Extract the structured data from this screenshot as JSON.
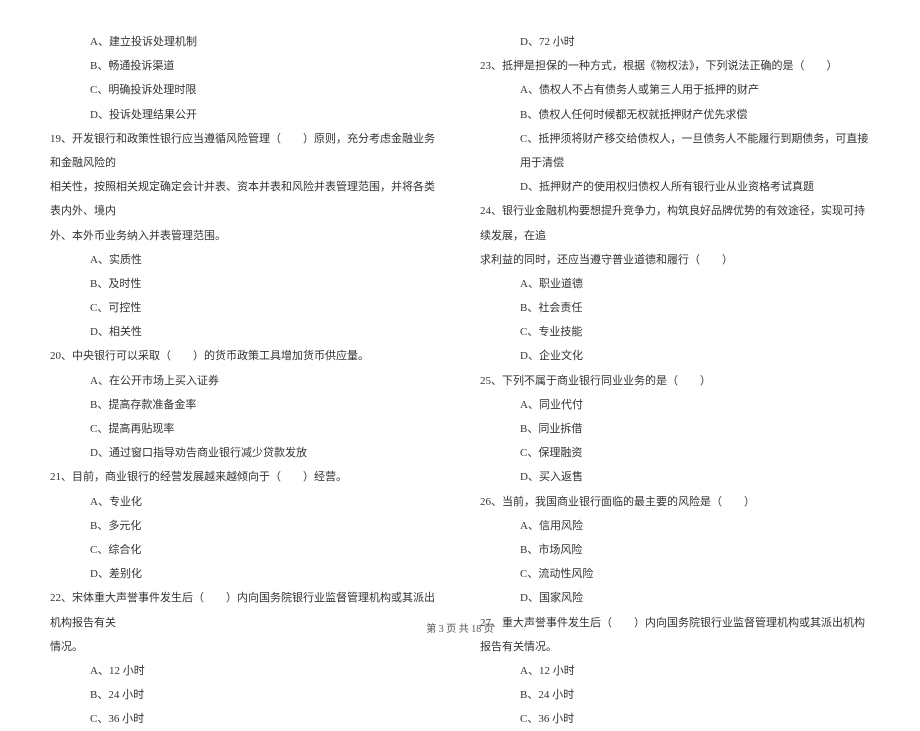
{
  "left_column": {
    "q18_opts": {
      "a": "A、建立投诉处理机制",
      "b": "B、畅通投诉渠道",
      "c": "C、明确投诉处理时限",
      "d": "D、投诉处理结果公开"
    },
    "q19": {
      "stem1": "19、开发银行和政策性银行应当遵循风险管理（　　）原则，充分考虑金融业务和金融风险的",
      "stem2": "相关性，按照相关规定确定会计并表、资本并表和风险并表管理范围，并将各类表内外、境内",
      "stem3": "外、本外币业务纳入并表管理范围。",
      "a": "A、实质性",
      "b": "B、及时性",
      "c": "C、可控性",
      "d": "D、相关性"
    },
    "q20": {
      "stem": "20、中央银行可以采取（　　）的货币政策工具增加货币供应量。",
      "a": "A、在公开市场上买入证券",
      "b": "B、提高存款准备金率",
      "c": "C、提高再贴现率",
      "d": "D、通过窗口指导劝告商业银行减少贷款发放"
    },
    "q21": {
      "stem": "21、目前，商业银行的经营发展越来越倾向于（　　）经营。",
      "a": "A、专业化",
      "b": "B、多元化",
      "c": "C、综合化",
      "d": "D、差别化"
    },
    "q22": {
      "stem1": "22、宋体重大声誉事件发生后（　　）内向国务院银行业监督管理机构或其派出机构报告有关",
      "stem2": "情况。",
      "a": "A、12 小时",
      "b": "B、24 小时",
      "c": "C、36 小时"
    }
  },
  "right_column": {
    "q22_d": "D、72 小时",
    "q23": {
      "stem": "23、抵押是担保的一种方式，根据《物权法》，下列说法正确的是（　　）",
      "a": "A、债权人不占有债务人或第三人用于抵押的财产",
      "b": "B、债权人任何时候都无权就抵押财产优先求偿",
      "c": "C、抵押须将财产移交给债权人，一旦债务人不能履行到期债务，可直接用于清偿",
      "d": "D、抵押财产的使用权归债权人所有银行业从业资格考试真题"
    },
    "q24": {
      "stem1": "24、银行业金融机构要想提升竞争力，构筑良好品牌优势的有效途径，实现可持续发展，在追",
      "stem2": "求利益的同时，还应当遵守普业道德和履行（　　）",
      "a": "A、职业道德",
      "b": "B、社会责任",
      "c": "C、专业技能",
      "d": "D、企业文化"
    },
    "q25": {
      "stem": "25、下列不属于商业银行同业业务的是（　　）",
      "a": "A、同业代付",
      "b": "B、同业拆借",
      "c": "C、保理融资",
      "d": "D、买入返售"
    },
    "q26": {
      "stem": "26、当前，我国商业银行面临的最主要的风险是（　　）",
      "a": "A、信用风险",
      "b": "B、市场风险",
      "c": "C、流动性风险",
      "d": "D、国家风险"
    },
    "q27": {
      "stem": "27、重大声誉事件发生后（　　）内向国务院银行业监督管理机构或其派出机构报告有关情况。",
      "a": "A、12 小时",
      "b": "B、24 小时",
      "c": "C、36 小时"
    }
  },
  "footer": "第 3 页 共 18 页"
}
